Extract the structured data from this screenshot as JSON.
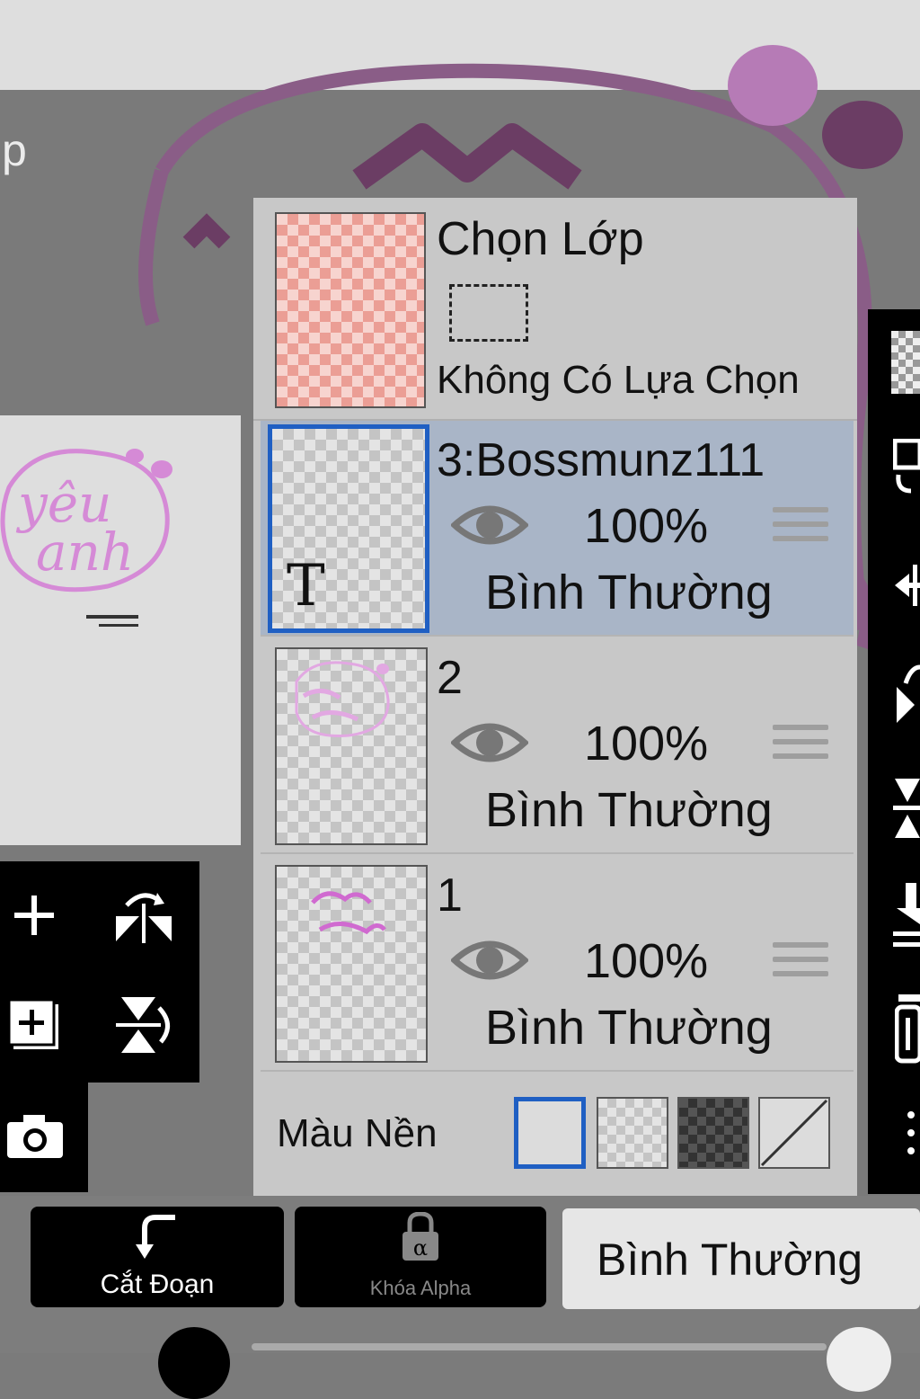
{
  "colors": {
    "accent": "#1f5fc3",
    "active_row": "#a9b5c7",
    "panel": "#c8c8c8",
    "art_pink": "#d58ad6"
  },
  "header": {
    "partial_title": "p"
  },
  "layers_panel": {
    "selection_layer": {
      "title": "Chọn Lớp",
      "status": "Không Có Lựa Chọn"
    },
    "layers": [
      {
        "name": "3:Bossmunz111",
        "opacity": "100%",
        "blend": "Bình Thường",
        "active": true,
        "type_icon": "T"
      },
      {
        "name": "2",
        "opacity": "100%",
        "blend": "Bình Thường",
        "active": false
      },
      {
        "name": "1",
        "opacity": "100%",
        "blend": "Bình Thường",
        "active": false
      }
    ],
    "background": {
      "label": "Màu Nền",
      "options": [
        "white",
        "light-checker",
        "dark-checker",
        "none"
      ],
      "selected": "white"
    }
  },
  "preview": {
    "art_text_line1": "yêu",
    "art_text_line2": "anh"
  },
  "bottom_toolbar": {
    "clipping_label": "Cắt Đoạn",
    "alpha_lock_label": "Khóa Alpha",
    "blend_mode_value": "Bình Thường"
  },
  "icons": [
    "plus-icon",
    "flip-horizontal-icon",
    "add-layer-icon",
    "flip-vertical-icon",
    "camera-icon",
    "eye-icon",
    "drag-handle-icon",
    "lock-icon",
    "clip-arrow-icon",
    "checker-icon",
    "move-icon",
    "rotate-icon",
    "merge-down-icon",
    "trash-icon",
    "more-icon"
  ]
}
